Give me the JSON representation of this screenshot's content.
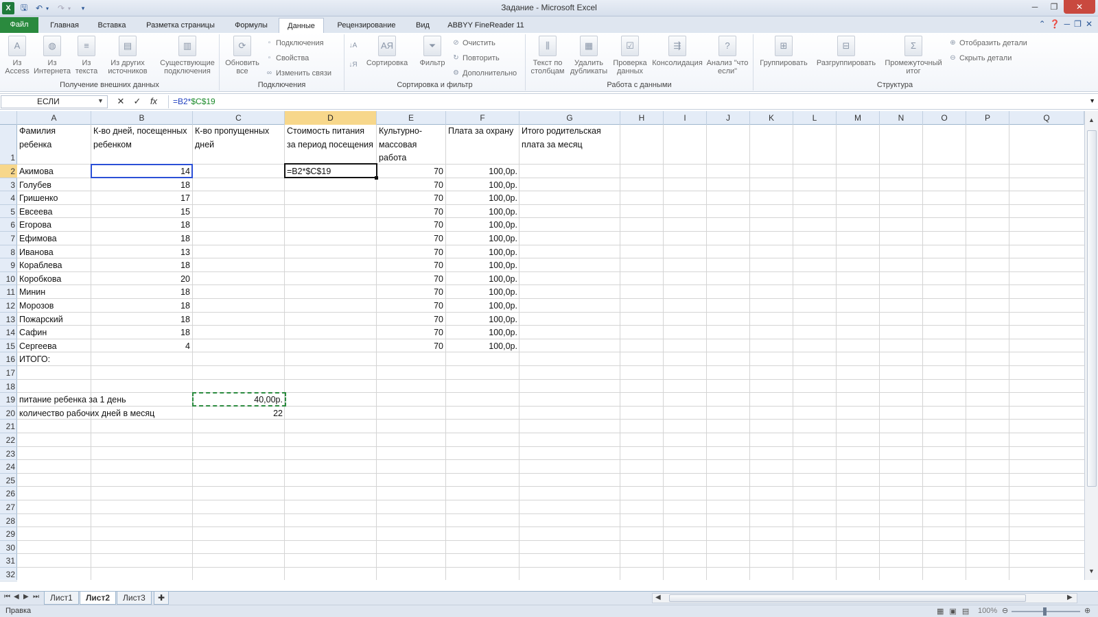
{
  "window": {
    "title": "Задание - Microsoft Excel",
    "minimize": "─",
    "maximize": "❐",
    "close": "✕"
  },
  "quick_access": {
    "logo": "X",
    "save_icon": "save-icon",
    "undo_icon": "undo-icon",
    "redo_icon": "redo-icon"
  },
  "ribbon_tabs": [
    "Файл",
    "Главная",
    "Вставка",
    "Разметка страницы",
    "Формулы",
    "Данные",
    "Рецензирование",
    "Вид",
    "ABBYY FineReader 11"
  ],
  "active_tab": "Данные",
  "ribbon": {
    "groups": [
      {
        "label": "Получение внешних данных",
        "buttons": [
          "Из Access",
          "Из Интернета",
          "Из текста",
          "Из других источников",
          "Существующие подключения"
        ]
      },
      {
        "label": "Подключения",
        "big": "Обновить все",
        "small": [
          "Подключения",
          "Свойства",
          "Изменить связи"
        ]
      },
      {
        "label": "Сортировка и фильтр",
        "big": [
          "Сортировка",
          "Фильтр"
        ],
        "small": [
          "Очистить",
          "Повторить",
          "Дополнительно"
        ]
      },
      {
        "label": "Работа с данными",
        "buttons": [
          "Текст по столбцам",
          "Удалить дубликаты",
          "Проверка данных",
          "Консолидация",
          "Анализ \"что если\""
        ]
      },
      {
        "label": "Структура",
        "buttons": [
          "Группировать",
          "Разгруппировать",
          "Промежуточный итог"
        ],
        "small": [
          "Отобразить детали",
          "Скрыть детали"
        ]
      }
    ]
  },
  "formula_bar": {
    "name_box": "ЕСЛИ",
    "formula_part1": "=B2*",
    "formula_part2": "$C$19",
    "cancel": "✕",
    "enter": "✓",
    "fx": "fx"
  },
  "columns": [
    "A",
    "B",
    "C",
    "D",
    "E",
    "F",
    "G",
    "H",
    "I",
    "J",
    "K",
    "L",
    "M",
    "N",
    "O",
    "P",
    "Q"
  ],
  "selected_column": "D",
  "rows": [
    "1",
    "2",
    "3",
    "4",
    "5",
    "6",
    "7",
    "8",
    "9",
    "10",
    "11",
    "12",
    "13",
    "14",
    "15",
    "16",
    "17",
    "18",
    "19",
    "20",
    "21",
    "22",
    "23",
    "24",
    "25",
    "26",
    "27",
    "28",
    "29",
    "30",
    "31",
    "32"
  ],
  "selected_row": "2",
  "headers": {
    "a": "Фамилия ребенка",
    "b": "К-во дней, посещенных ребенком",
    "c": "К-во пропущенных дней",
    "d": "Стоимость питания за период посещения",
    "e": "Культурно-массовая работа",
    "f": "Плата за охрану",
    "g": "Итого родительская плата за месяц"
  },
  "table_rows": [
    {
      "name": "Акимова",
      "days": "14",
      "culture": "70",
      "guard": "100,0р."
    },
    {
      "name": "Голубев",
      "days": "18",
      "culture": "70",
      "guard": "100,0р."
    },
    {
      "name": "Гришенко",
      "days": "17",
      "culture": "70",
      "guard": "100,0р."
    },
    {
      "name": "Евсеева",
      "days": "15",
      "culture": "70",
      "guard": "100,0р."
    },
    {
      "name": "Егорова",
      "days": "18",
      "culture": "70",
      "guard": "100,0р."
    },
    {
      "name": "Ефимова",
      "days": "18",
      "culture": "70",
      "guard": "100,0р."
    },
    {
      "name": "Иванова",
      "days": "13",
      "culture": "70",
      "guard": "100,0р."
    },
    {
      "name": "Кораблева",
      "days": "18",
      "culture": "70",
      "guard": "100,0р."
    },
    {
      "name": "Коробкова",
      "days": "20",
      "culture": "70",
      "guard": "100,0р."
    },
    {
      "name": "Минин",
      "days": "18",
      "culture": "70",
      "guard": "100,0р."
    },
    {
      "name": "Морозов",
      "days": "18",
      "culture": "70",
      "guard": "100,0р."
    },
    {
      "name": "Пожарский",
      "days": "18",
      "culture": "70",
      "guard": "100,0р."
    },
    {
      "name": "Сафин",
      "days": "18",
      "culture": "70",
      "guard": "100,0р."
    },
    {
      "name": "Сергеева",
      "days": "4",
      "culture": "70",
      "guard": "100,0р."
    }
  ],
  "editing_cell": "=B2*$C$19",
  "total_label": "ИТОГО:",
  "food_label": "питание ребенка за 1 день",
  "food_value": "40,00р.",
  "workdays_label": "количество рабочих дней в месяц",
  "workdays_value": "22",
  "sheets": [
    "Лист1",
    "Лист2",
    "Лист3"
  ],
  "active_sheet": "Лист2",
  "status": {
    "mode": "Правка",
    "zoom": "100%"
  }
}
